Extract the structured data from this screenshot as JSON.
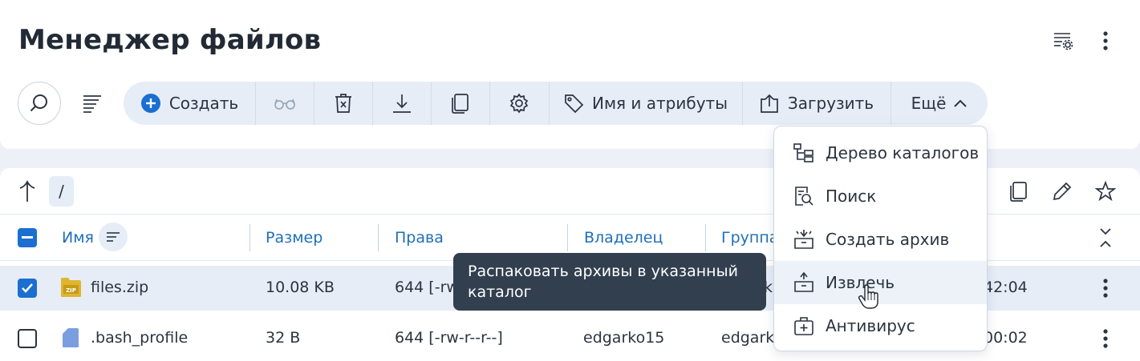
{
  "header": {
    "title": "Менеджер файлов",
    "settings_icon": "list-settings-icon",
    "menu_icon": "kebab-menu-icon"
  },
  "toolbar": {
    "search_icon": "search-icon",
    "sort_icon": "sort-lines-icon",
    "create_label": "Создать",
    "attributes_label": "Имя и атрибуты",
    "upload_label": "Загрузить",
    "more_label": "Ещё"
  },
  "more_menu": {
    "items": [
      {
        "label": "Дерево каталогов",
        "icon": "folder-tree-icon"
      },
      {
        "label": "Поиск",
        "icon": "doc-search-icon"
      },
      {
        "label": "Создать архив",
        "icon": "archive-create-icon"
      },
      {
        "label": "Извлечь",
        "icon": "archive-extract-icon"
      },
      {
        "label": "Антивирус",
        "icon": "antivirus-icon"
      }
    ]
  },
  "tooltip": {
    "text": "Распаковать архивы в указанный каталог"
  },
  "path": {
    "current": "/"
  },
  "table": {
    "columns": [
      "Имя",
      "Размер",
      "Права",
      "Владелец",
      "Группа"
    ],
    "rows": [
      {
        "name": "files.zip",
        "size": "10.08 KB",
        "perms": "644 [-rw",
        "owner": "",
        "group_frag": "k",
        "time_frag": "42:04",
        "checked": true
      },
      {
        "name": ".bash_profile",
        "size": "32 B",
        "perms": "644 [-rw-r--r--]",
        "owner": "edgarko15",
        "group_frag": "edgark",
        "time_frag": "00:02",
        "checked": false
      }
    ]
  },
  "colors": {
    "accent": "#1a6fd0",
    "toolbar_bg": "#e6edf7",
    "tooltip_bg": "#323f4f"
  }
}
